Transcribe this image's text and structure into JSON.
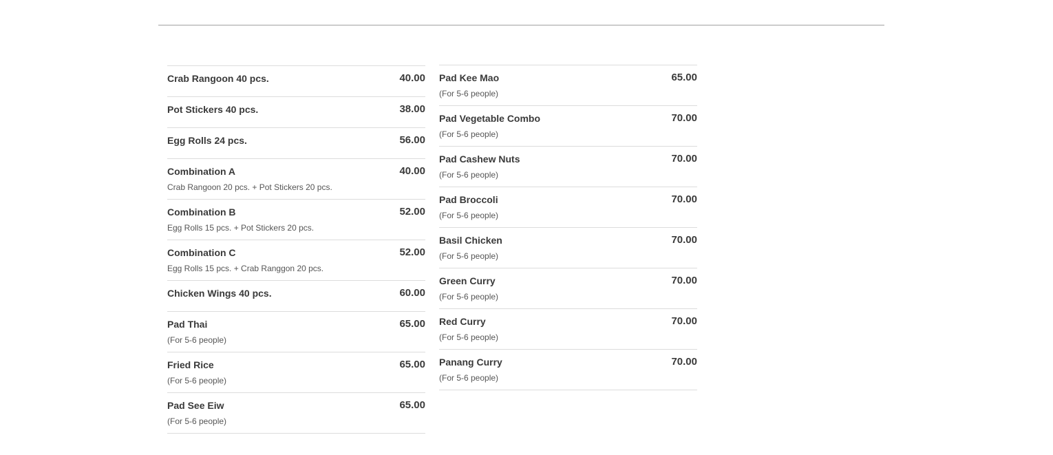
{
  "menu": {
    "left_column": [
      {
        "name": "Crab Rangoon 40 pcs.",
        "price": "40.00",
        "desc": ""
      },
      {
        "name": "Pot Stickers 40 pcs.",
        "price": "38.00",
        "desc": ""
      },
      {
        "name": "Egg Rolls 24 pcs.",
        "price": "56.00",
        "desc": ""
      },
      {
        "name": "Combination A",
        "price": "40.00",
        "desc": "Crab Rangoon 20 pcs. + Pot Stickers 20 pcs."
      },
      {
        "name": "Combination B",
        "price": "52.00",
        "desc": "Egg Rolls 15 pcs. + Pot Stickers 20 pcs."
      },
      {
        "name": "Combination C",
        "price": "52.00",
        "desc": "Egg Rolls 15 pcs. + Crab Ranggon 20 pcs."
      },
      {
        "name": "Chicken Wings 40 pcs.",
        "price": "60.00",
        "desc": ""
      },
      {
        "name": "Pad Thai",
        "price": "65.00",
        "desc": "(For 5-6 people)"
      },
      {
        "name": "Fried Rice",
        "price": "65.00",
        "desc": "(For 5-6 people)"
      },
      {
        "name": "Pad See Eiw",
        "price": "65.00",
        "desc": "(For 5-6 people)"
      }
    ],
    "right_column": [
      {
        "name": "Pad Kee Mao",
        "price": "65.00",
        "desc": "(For 5-6 people)"
      },
      {
        "name": "Pad Vegetable Combo",
        "price": "70.00",
        "desc": "(For 5-6 people)"
      },
      {
        "name": "Pad Cashew Nuts",
        "price": "70.00",
        "desc": "(For 5-6 people)"
      },
      {
        "name": "Pad Broccoli",
        "price": "70.00",
        "desc": "(For 5-6 people)"
      },
      {
        "name": "Basil Chicken",
        "price": "70.00",
        "desc": "(For 5-6 people)"
      },
      {
        "name": "Green Curry",
        "price": "70.00",
        "desc": "(For 5-6 people)"
      },
      {
        "name": "Red Curry",
        "price": "70.00",
        "desc": "(For 5-6 people)"
      },
      {
        "name": "Panang Curry",
        "price": "70.00",
        "desc": "(For 5-6 people)"
      }
    ]
  }
}
